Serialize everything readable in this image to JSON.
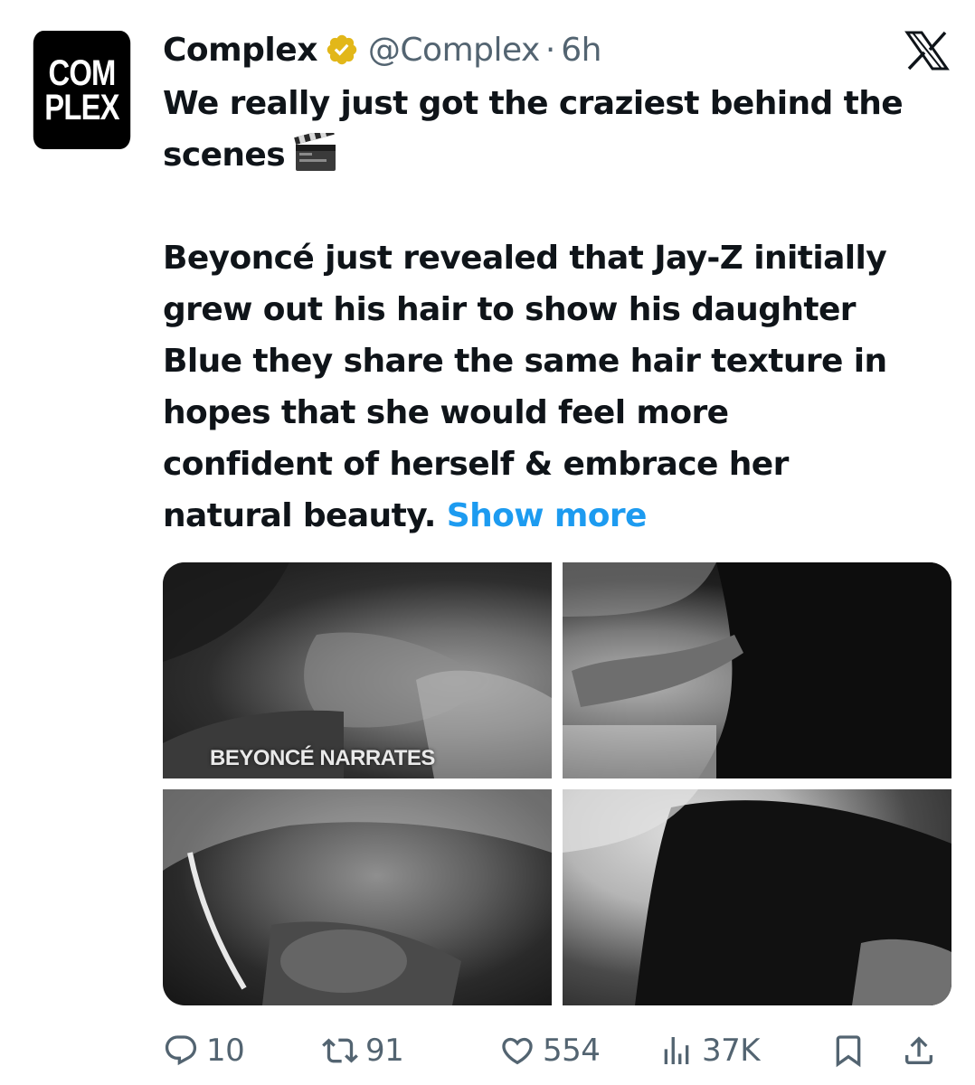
{
  "tweet": {
    "avatar_text": [
      "COM",
      "PLEX"
    ],
    "display_name": "Complex",
    "handle": "@Complex",
    "separator": "·",
    "time": "6h",
    "text_lines": [
      "We really just got the craziest behind the",
      "scenes",
      "",
      "Beyoncé just revealed that Jay-Z initially",
      "grew out his hair to show his daughter",
      "Blue they share the same hair texture in",
      "hopes that she would feel more",
      "confident of herself & embrace her",
      "natural beauty."
    ],
    "show_more": "Show more",
    "media": {
      "caption": "BEYONCÉ NARRATES"
    },
    "stats": {
      "replies": "10",
      "reposts": "91",
      "likes": "554",
      "views": "37K"
    }
  },
  "icons": {
    "verified": "verified-badge-icon",
    "close": "x-logo-icon",
    "clapper": "clapper-board-emoji",
    "reply": "reply-icon",
    "repost": "repost-icon",
    "like": "heart-icon",
    "views": "views-icon",
    "bookmark": "bookmark-icon",
    "share": "share-icon"
  },
  "colors": {
    "link": "#1d9bf0",
    "secondary_text": "#536471",
    "verified_gold": "#e2b719"
  }
}
